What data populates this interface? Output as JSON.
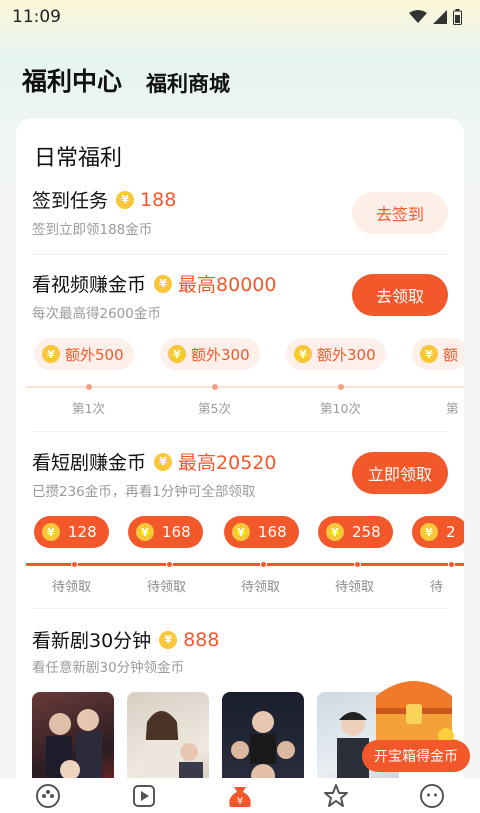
{
  "status": {
    "time": "11:09"
  },
  "header": {
    "tab_active": "福利中心",
    "tab_other": "福利商城"
  },
  "daily": {
    "title": "日常福利",
    "checkin": {
      "title": "签到任务",
      "reward": "188",
      "sub": "签到立即领188金币",
      "button": "去签到"
    },
    "video": {
      "title": "看视频赚金币",
      "reward": "最高80000",
      "sub": "每次最高得2600金币",
      "button": "去领取",
      "bonuses": [
        "额外500",
        "额外300",
        "额外300",
        "额"
      ],
      "ticks": [
        "第1次",
        "第5次",
        "第10次",
        "第"
      ]
    },
    "drama": {
      "title": "看短剧赚金币",
      "reward": "最高20520",
      "sub": "已攒236金币，再看1分钟可全部领取",
      "button": "立即领取",
      "bonuses": [
        "128",
        "168",
        "168",
        "258",
        "2"
      ],
      "ticks": [
        "待领取",
        "待领取",
        "待领取",
        "待领取",
        "待"
      ]
    },
    "newdrama": {
      "title": "看新剧30分钟",
      "reward": "888",
      "sub": "看任意新剧30分钟领金币"
    }
  },
  "chest": {
    "label": "开宝箱得金币"
  },
  "coin_symbol": "¥",
  "nav": {
    "items": [
      "game-icon",
      "play-icon",
      "welfare-icon",
      "star-icon",
      "profile-icon"
    ]
  },
  "colors": {
    "accent": "#f3582b",
    "coin": "#f8c73a"
  }
}
